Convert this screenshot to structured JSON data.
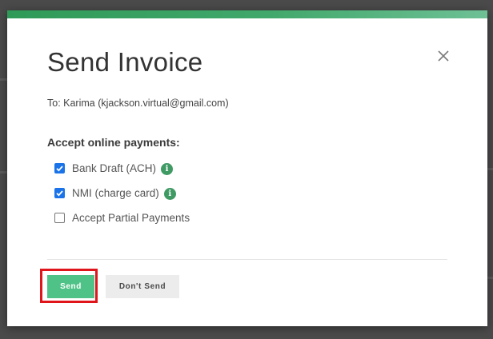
{
  "dialog": {
    "title": "Send Invoice",
    "recipient": "To: Karima (kjackson.virtual@gmail.com)",
    "payments_heading": "Accept online payments:",
    "options": [
      {
        "label": "Bank Draft (ACH)",
        "checked": true,
        "info_icon": "info-icon"
      },
      {
        "label": "NMI (charge card)",
        "checked": true,
        "info_icon": "info-icon"
      },
      {
        "label": "Accept Partial Payments",
        "checked": false
      }
    ],
    "info_glyph": "i",
    "buttons": {
      "send": "Send",
      "dont_send": "Don't Send"
    }
  },
  "colors": {
    "accent": "#41a86b",
    "send_button": "#4fc387",
    "checkbox_checked": "#1a73e8",
    "highlight": "#e0141b"
  },
  "icons": {
    "close": "close-icon",
    "checkmark": "checkmark-icon"
  }
}
